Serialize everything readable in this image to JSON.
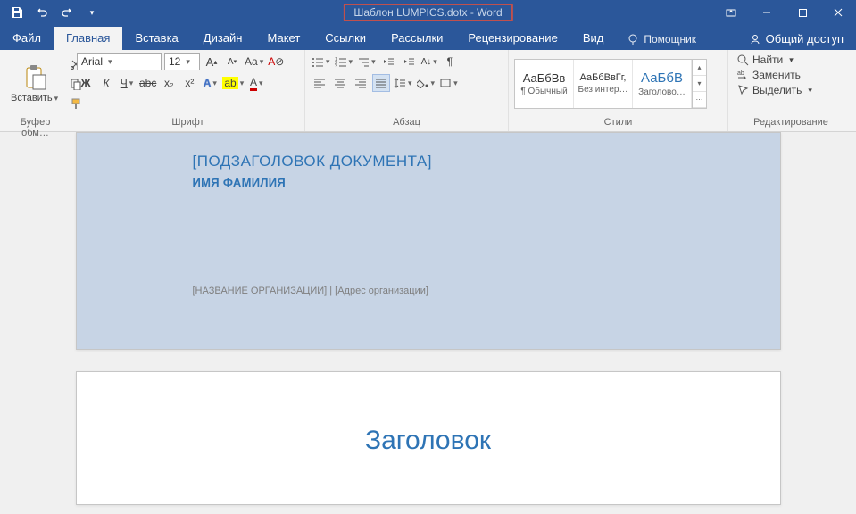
{
  "title": "Шаблон LUMPICS.dotx - Word",
  "tabs": {
    "file": "Файл",
    "home": "Главная",
    "insert": "Вставка",
    "design": "Дизайн",
    "layout": "Макет",
    "references": "Ссылки",
    "mailings": "Рассылки",
    "review": "Рецензирование",
    "view": "Вид",
    "assistant": "Помощник",
    "share": "Общий доступ"
  },
  "ribbon": {
    "clipboard": {
      "label": "Буфер обм…",
      "paste": "Вставить"
    },
    "font": {
      "label": "Шрифт",
      "name": "Arial",
      "size": "12",
      "bold": "Ж",
      "italic": "К",
      "underline": "Ч",
      "strike": "abc",
      "sub": "x₂",
      "sup": "x²",
      "case": "Aa",
      "clear": "✕"
    },
    "paragraph": {
      "label": "Абзац"
    },
    "styles": {
      "label": "Стили",
      "items": [
        {
          "sample": "АаБбВв",
          "sample_color": "#333",
          "name": "¶ Обычный"
        },
        {
          "sample": "АаБбВвГг,",
          "sample_color": "#333",
          "name": "Без интер…"
        },
        {
          "sample": "АаБбВ",
          "sample_color": "#2e74b5",
          "name": "Заголово…"
        }
      ]
    },
    "editing": {
      "label": "Редактирование",
      "find": "Найти",
      "replace": "Заменить",
      "select": "Выделить"
    }
  },
  "document": {
    "subtitle": "[ПОДЗАГОЛОВОК ДОКУМЕНТА]",
    "author": "ИМЯ ФАМИЛИЯ",
    "footer": "[НАЗВАНИЕ ОРГАНИЗАЦИИ] | [Адрес организации]",
    "heading": "Заголовок"
  }
}
